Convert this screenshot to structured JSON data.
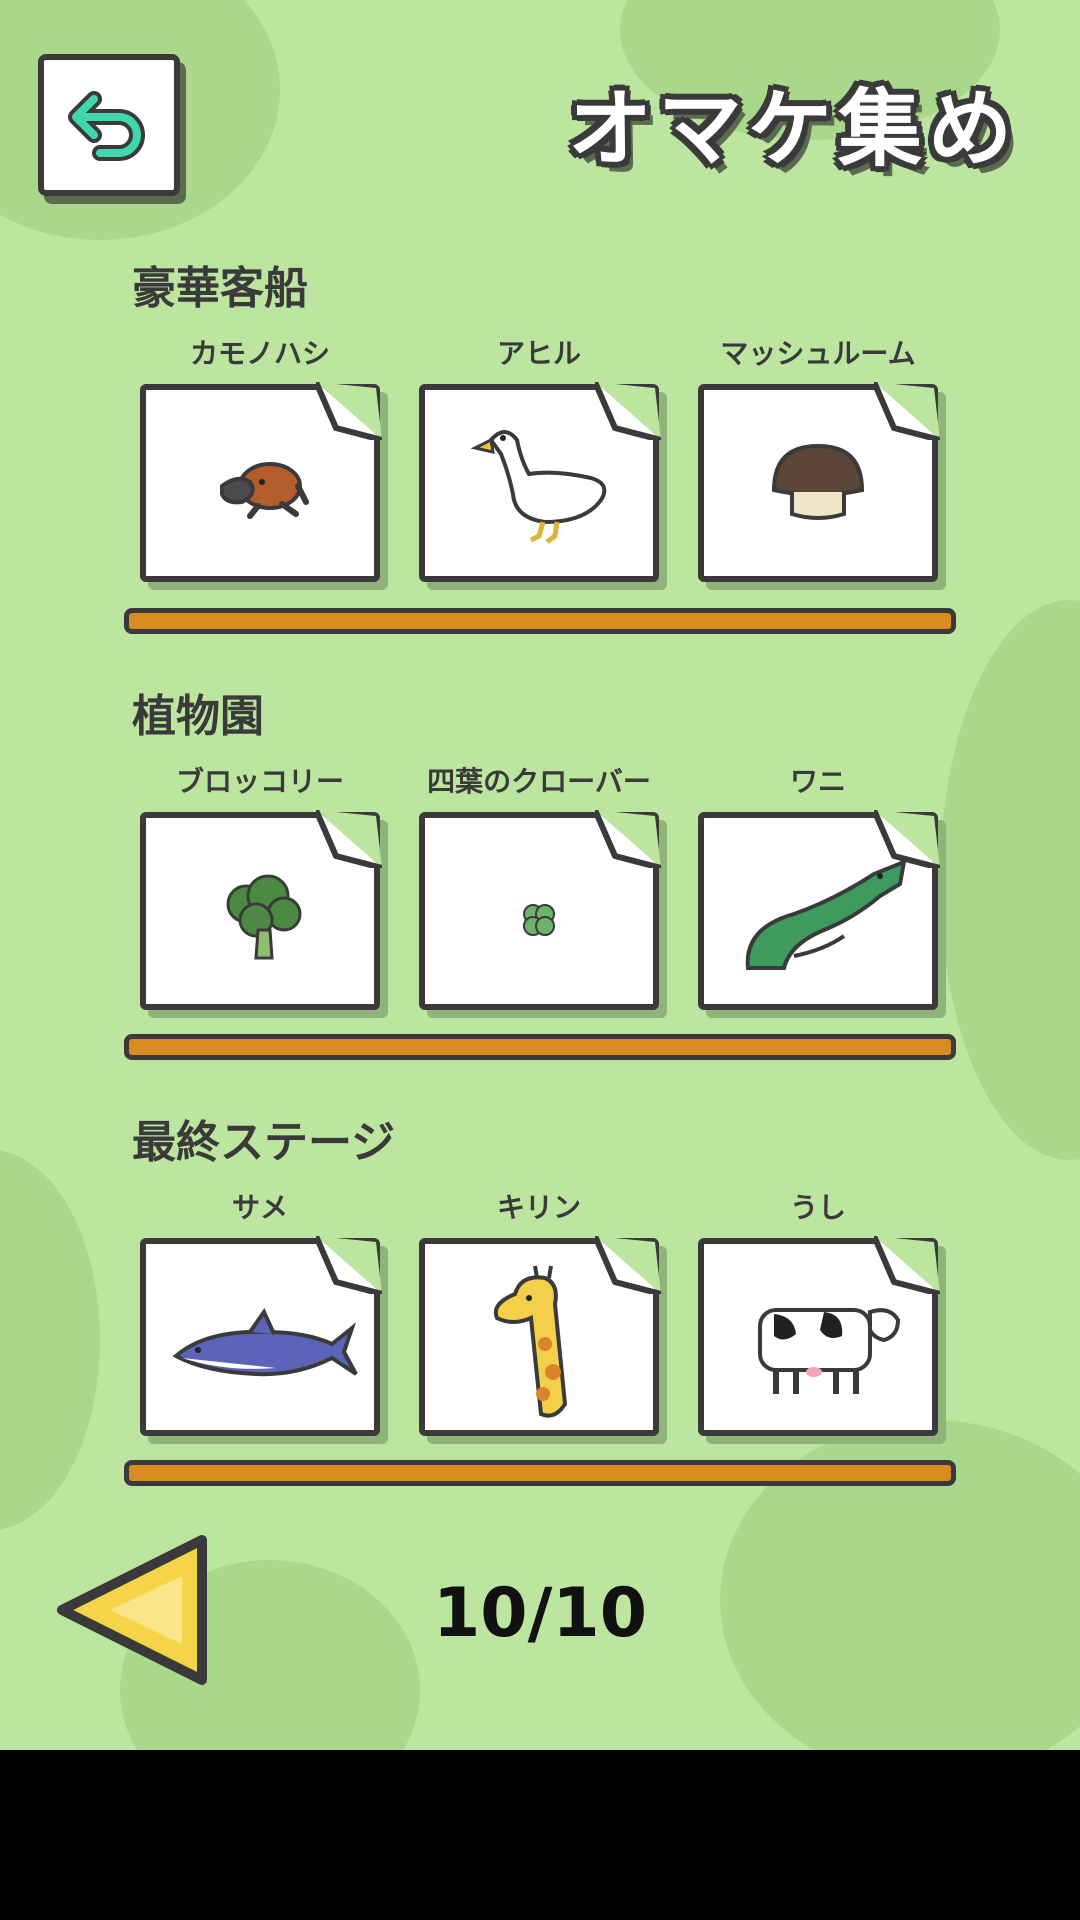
{
  "header": {
    "title": "オマケ集め"
  },
  "sections": [
    {
      "title": "豪華客船",
      "items": [
        {
          "label": "カモノハシ",
          "icon": "platypus-icon"
        },
        {
          "label": "アヒル",
          "icon": "duck-icon"
        },
        {
          "label": "マッシュルーム",
          "icon": "mushroom-icon"
        }
      ]
    },
    {
      "title": "植物園",
      "items": [
        {
          "label": "ブロッコリー",
          "icon": "broccoli-icon"
        },
        {
          "label": "四葉のクローバー",
          "icon": "clover-icon"
        },
        {
          "label": "ワニ",
          "icon": "crocodile-icon"
        }
      ]
    },
    {
      "title": "最終ステージ",
      "items": [
        {
          "label": "サメ",
          "icon": "shark-icon"
        },
        {
          "label": "キリン",
          "icon": "giraffe-icon"
        },
        {
          "label": "うし",
          "icon": "cow-icon"
        }
      ]
    }
  ],
  "pagination": {
    "text": "10/10"
  },
  "colors": {
    "background": "#bce59f",
    "shelf": "#d98c1f",
    "outline": "#3a3a3a",
    "back_arrow": "#3fd6b0",
    "prev_arrow": "#f5d547"
  }
}
